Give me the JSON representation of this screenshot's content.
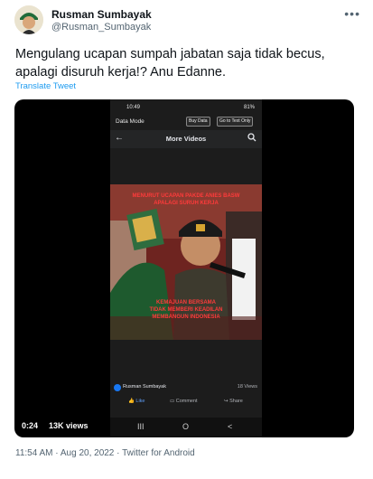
{
  "author": {
    "name": "Rusman Sumbayak",
    "handle": "@Rusman_Sumbayak"
  },
  "more_icon": "ellipsis-icon",
  "tweet": {
    "text_line1": "Mengulang ucapan sumpah jabatan saja tidak becus,",
    "text_line2": "apalagi disuruh kerja!? Anu Edanne.",
    "translate_label": "Translate Tweet"
  },
  "video": {
    "timestamp": "0:24",
    "views": "13K views",
    "phone": {
      "time": "10:49",
      "status": "81%",
      "data_mode": "Data Mode",
      "buy_data": "Buy Data",
      "go_text": "Go to Text Only",
      "page_title": "More Videos",
      "caption_top1": "MENURUT UCAPAN PAKDE ANIES BASW",
      "caption_top2": "APALAGI SURUH KERJA",
      "caption_bottom1": "KEMAJUAN BERSAMA",
      "caption_bottom2": "TIDAK MEMBERI KEADILAN",
      "caption_bottom3": "MEMBANGUN INDONESIA",
      "poster_name": "Rusman Sumbayak",
      "view_count": "18 Views",
      "like": "Like",
      "comment": "Comment",
      "share": "Share",
      "nav_recent": "III",
      "nav_home": "O",
      "nav_back": "<"
    }
  },
  "meta": {
    "time": "11:54 AM",
    "date": "Aug 20, 2022",
    "source": "Twitter for Android",
    "separator": "·"
  }
}
